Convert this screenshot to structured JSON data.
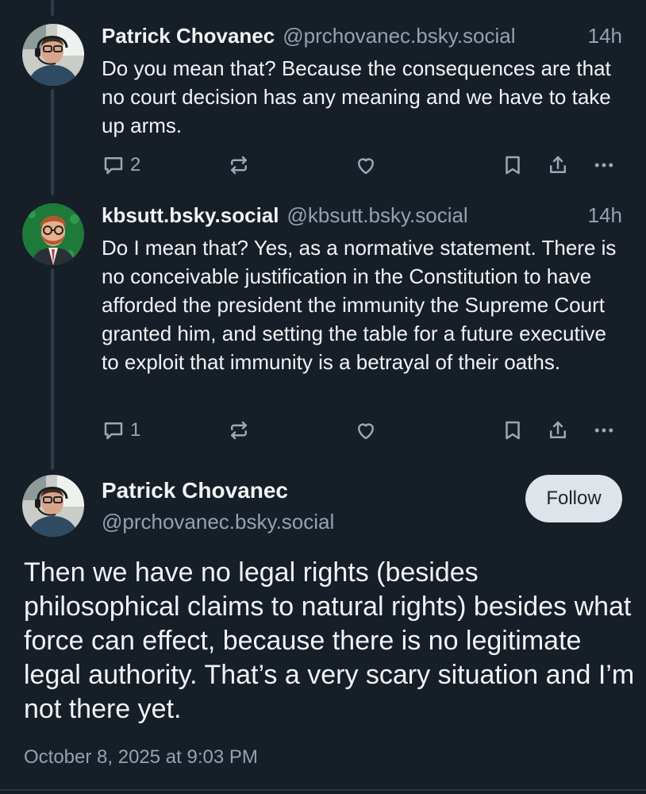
{
  "posts": [
    {
      "author_name": "Patrick Chovanec",
      "author_handle": "@prchovanec.bsky.social",
      "time": "14h",
      "text": "Do you mean that? Because the consequences are that no court decision has any meaning and we have to take up arms.",
      "reply_count": "2",
      "avatar": "patrick-avatar"
    },
    {
      "author_name": "kbsutt.bsky.social",
      "author_handle": "@kbsutt.bsky.social",
      "time": "14h",
      "text": "Do I mean that? Yes, as a normative statement. There is no conceivable justification in the Constitution to have afforded the president the immunity the Supreme Court granted him, and setting the table for a future executive to exploit that immunity is a betrayal of their oaths.",
      "reply_count": "1",
      "avatar": "kbsutt-avatar"
    }
  ],
  "main_post": {
    "author_name": "Patrick Chovanec",
    "author_handle": "@prchovanec.bsky.social",
    "follow_label": "Follow",
    "text": "Then we have no legal rights (besides philosophical claims to natural rights) besides what force can effect, because there is no legitimate legal authority. That’s a very scary situation and I’m not there yet.",
    "timestamp": "October 8, 2025 at 9:03 PM"
  },
  "icons": {
    "reply": "reply-icon",
    "repost": "repost-icon",
    "like": "heart-icon",
    "bookmark": "bookmark-icon",
    "share": "share-icon",
    "more": "more-icon"
  },
  "colors": {
    "background": "#161e27",
    "text": "#f1f3f5",
    "muted": "#93a2b2",
    "thread_line": "#2e3c4a",
    "follow_button": "#dfe4ea"
  }
}
